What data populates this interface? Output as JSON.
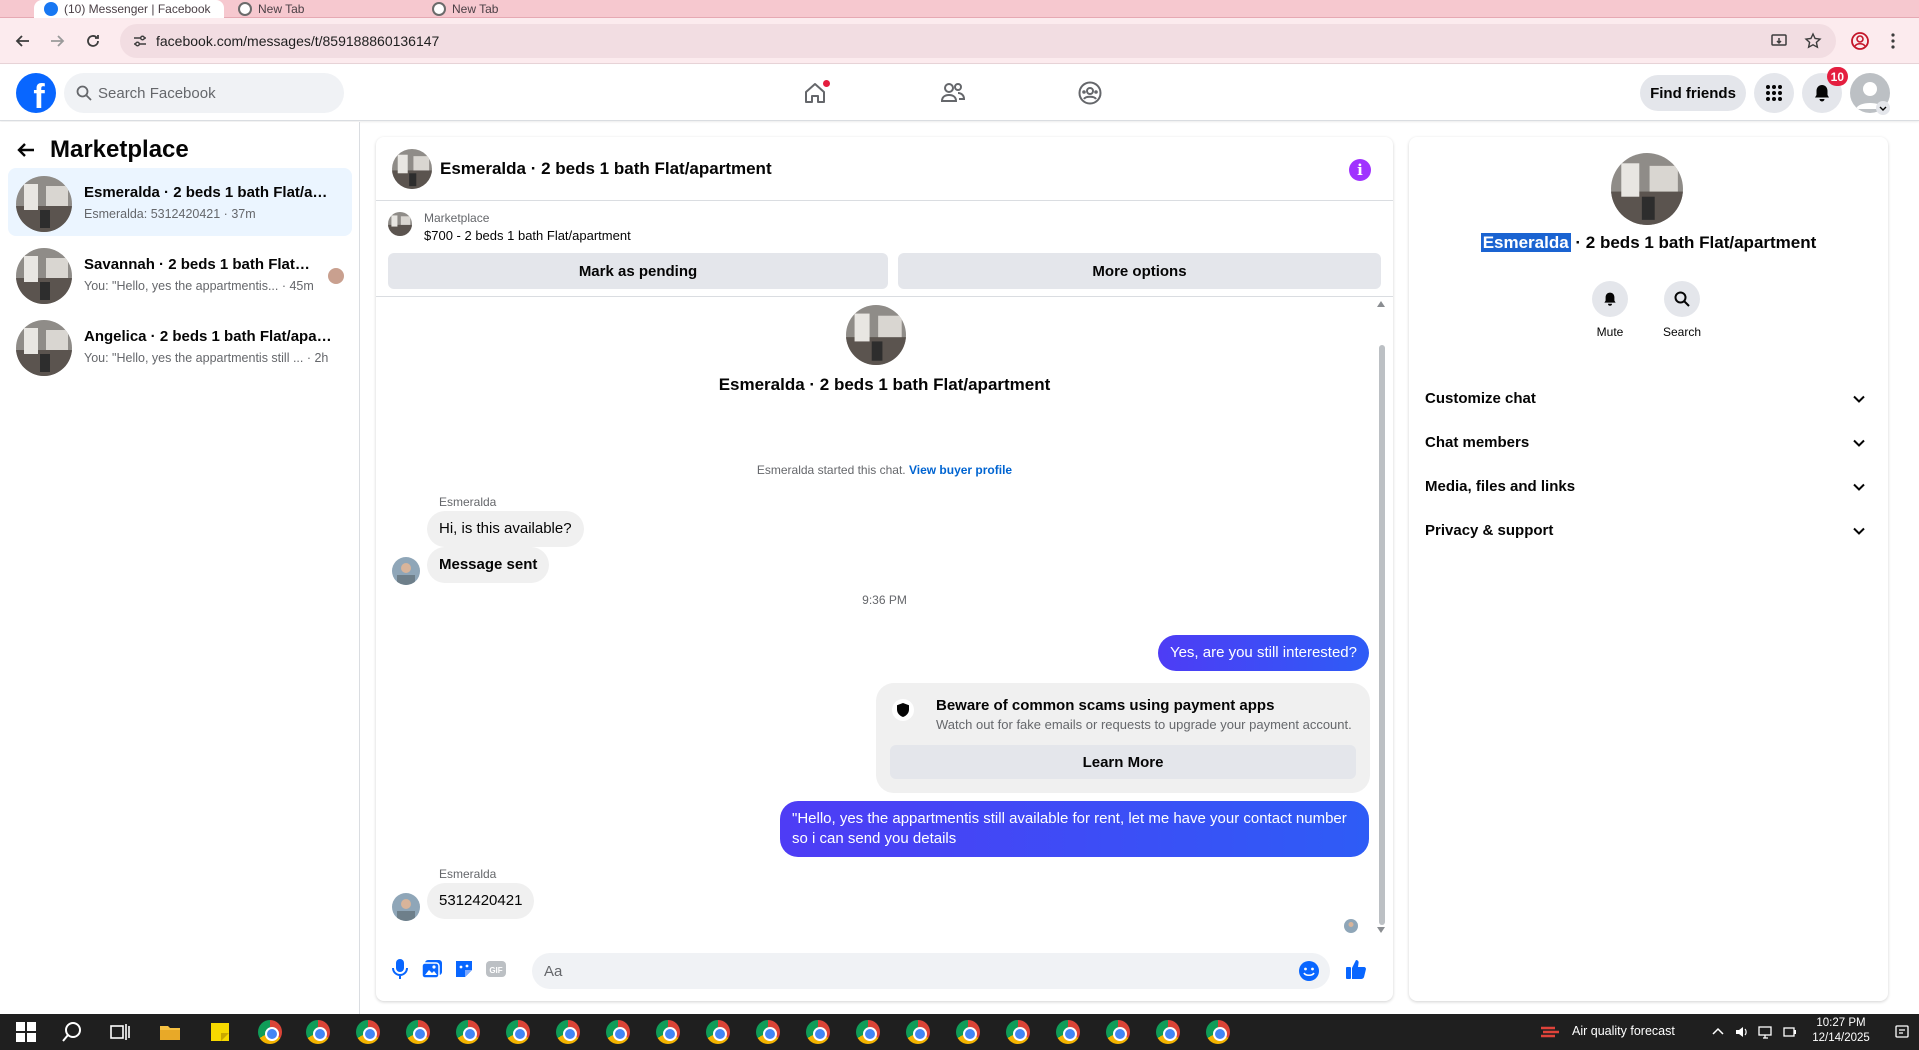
{
  "browser": {
    "tabs": [
      {
        "label": "(10) Messenger | Facebook"
      },
      {
        "label": "New Tab"
      },
      {
        "label": "New Tab"
      }
    ],
    "url": "facebook.com/messages/t/859188860136147"
  },
  "header": {
    "logo_letter": "f",
    "search_placeholder": "Search Facebook",
    "find_friends": "Find friends",
    "notifications_count": "10",
    "accent": "#0866ff"
  },
  "sidebar": {
    "title": "Marketplace",
    "conversations": [
      {
        "name": "Esmeralda · 2 beds 1 bath Flat/apa...",
        "preview": "Esmeralda: 5312420421 · 37m",
        "active": true
      },
      {
        "name": "Savannah · 2 beds 1 bath Flat/ap...",
        "preview": "You: \"Hello, yes the appartmentis... · 45m",
        "active": false
      },
      {
        "name": "Angelica · 2 beds 1 bath Flat/apart...",
        "preview": "You: \"Hello, yes the appartmentis still ... · 2h",
        "active": false
      }
    ]
  },
  "chat": {
    "title": "Esmeralda · 2 beds 1 bath Flat/apartment",
    "listing": {
      "source": "Marketplace",
      "price_title": "$700 - 2 beds 1 bath Flat/apartment",
      "mark_pending": "Mark as pending",
      "more_options": "More options"
    },
    "intro_title": "Esmeralda · 2 beds 1 bath Flat/apartment",
    "system_text": "Esmeralda started this chat.",
    "system_link": "View buyer profile",
    "messages": [
      {
        "sender": "Esmeralda",
        "text": "Hi, is this available?"
      },
      {
        "text": "Message sent"
      },
      {
        "timestamp": "9:36 PM"
      },
      {
        "text": "Yes, are you still interested?"
      },
      {
        "text": "\"Hello, yes the appartmentis still available for rent, let me have your contact number so i can send you details"
      },
      {
        "sender": "Esmeralda",
        "text": "5312420421"
      }
    ],
    "scam_card": {
      "title": "Beware of common scams using payment apps",
      "body": "Watch out for fake emails or requests to upgrade your payment account.",
      "button": "Learn More"
    },
    "composer_placeholder": "Aa",
    "outgoing_color": "#3b47f5"
  },
  "details": {
    "name_highlighted": "Esmeralda",
    "name_rest": " · 2 beds 1 bath Flat/apartment",
    "actions": [
      "Mute",
      "Search"
    ],
    "sections": [
      "Customize chat",
      "Chat members",
      "Media, files and links",
      "Privacy & support"
    ]
  },
  "taskbar": {
    "weather": "Air quality forecast",
    "time": "10:27 PM",
    "date": "12/14/2025"
  }
}
